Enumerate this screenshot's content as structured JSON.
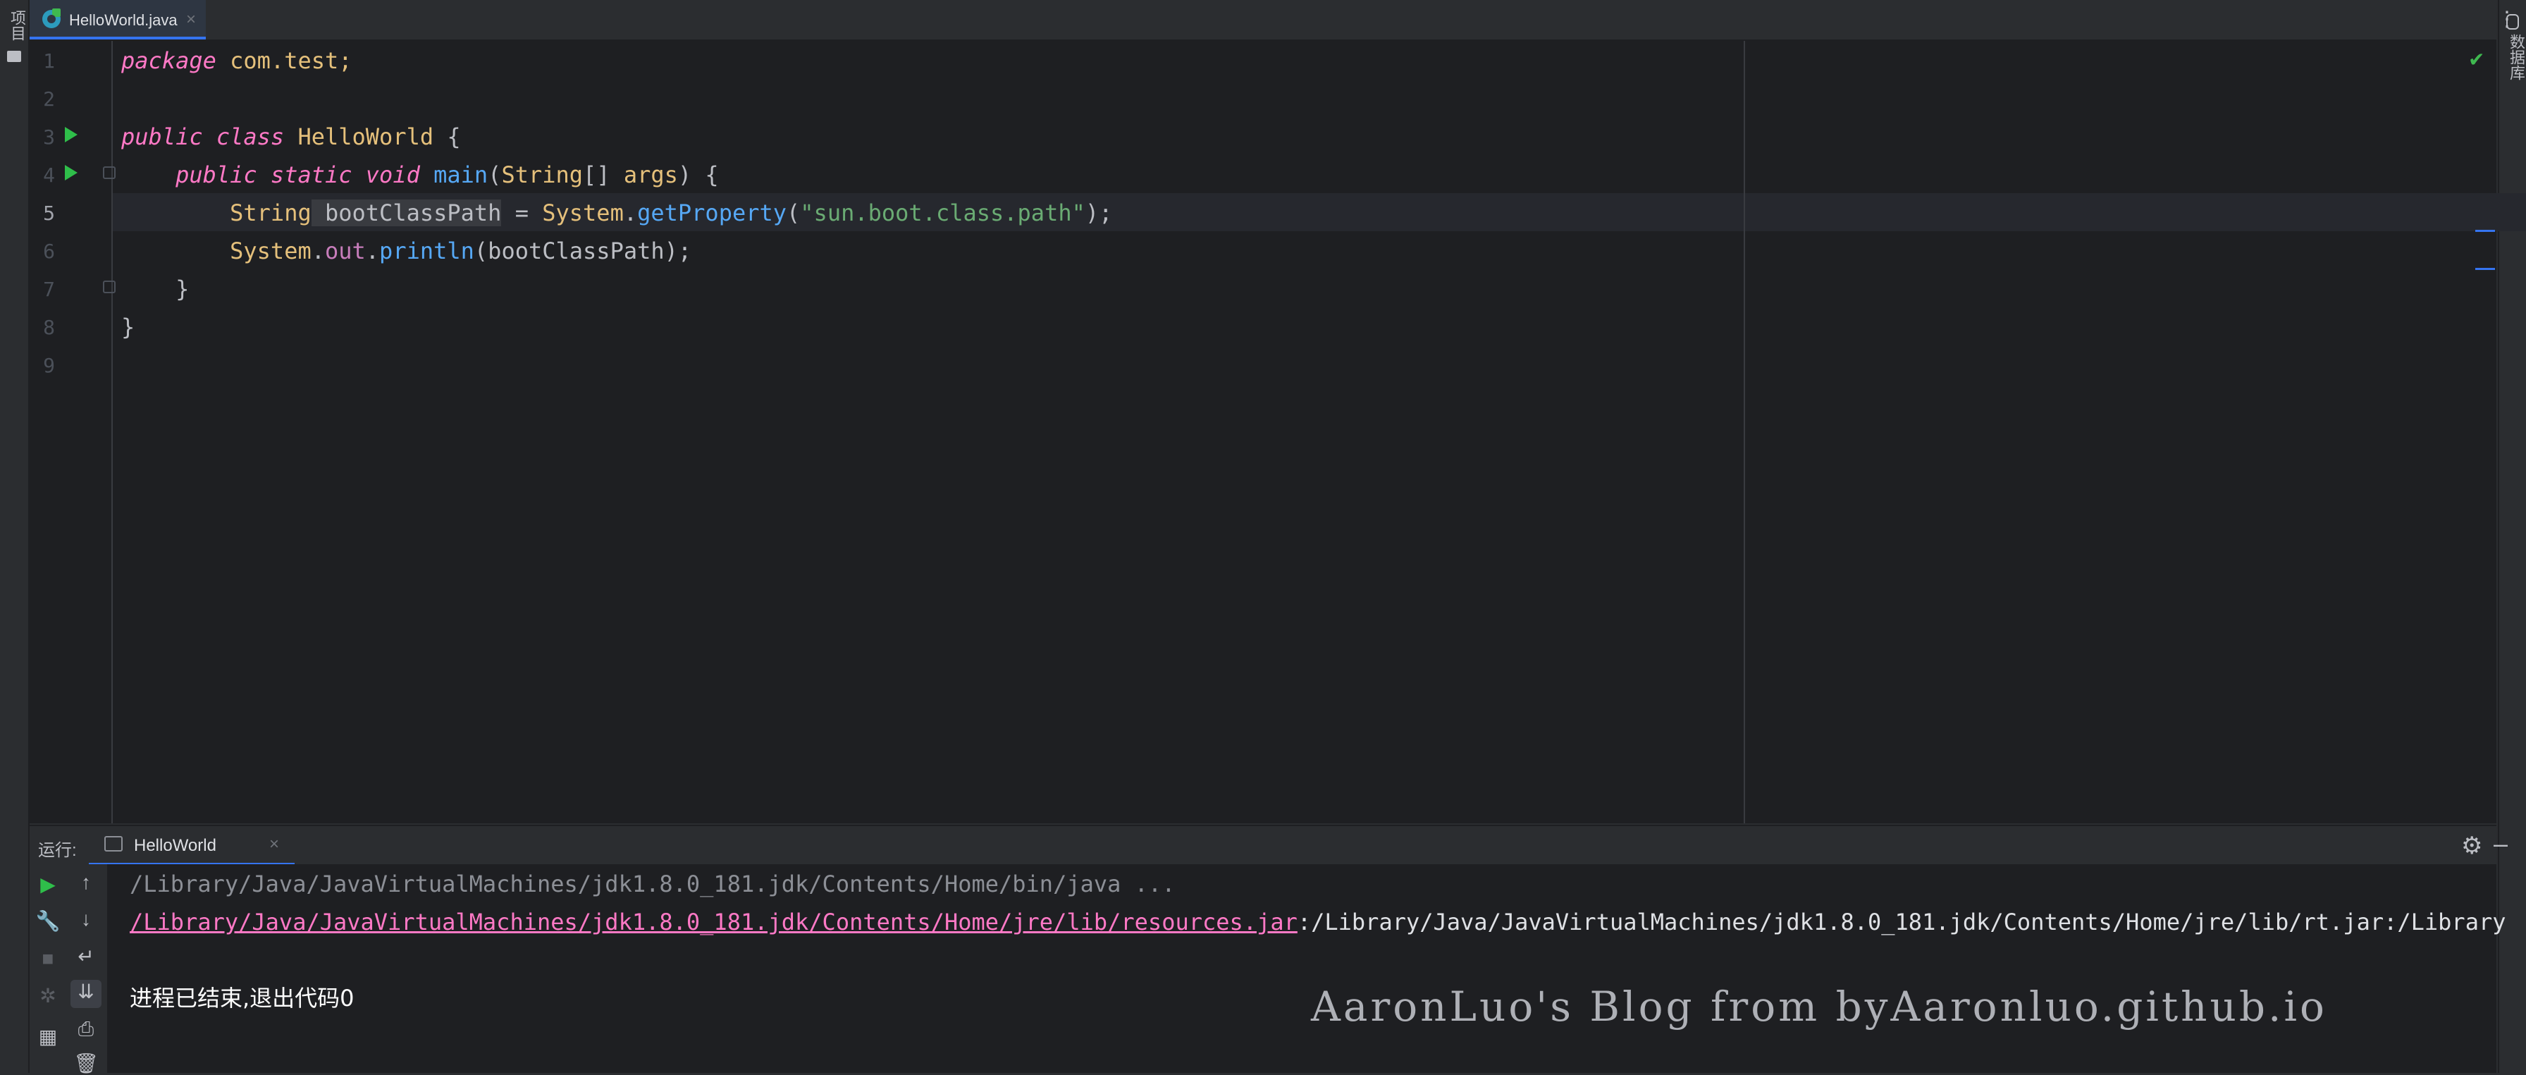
{
  "left_strip": {
    "project_label": "项目"
  },
  "right_strip": {
    "database_label": "数据库"
  },
  "editor_tab": {
    "label": "HelloWorld.java",
    "close": "×"
  },
  "editor": {
    "line_numbers": [
      "1",
      "2",
      "3",
      "4",
      "5",
      "6",
      "7",
      "8",
      "9"
    ],
    "code": {
      "l1": {
        "kw": "package",
        "rest": " com.test;"
      },
      "l3": {
        "kw1": "public",
        "kw2": " class",
        "type": " HelloWorld",
        "rest": " {"
      },
      "l4": {
        "indent": "    ",
        "kw1": "public",
        "kw2": " static",
        "kw3": " void",
        "fn": " main",
        "p1": "(",
        "type": "String",
        "p2": "[] ",
        "arg": "args",
        "p3": ") {"
      },
      "l5": {
        "indent": "        ",
        "type": "String",
        "var": " bootClassPath",
        "eq": " = ",
        "cls": "System",
        "dot": ".",
        "fn": "getProperty",
        "p1": "(",
        "str": "\"sun.boot.class.path\"",
        "p2": ");"
      },
      "l6": {
        "indent": "        ",
        "cls": "System",
        "dot1": ".",
        "field": "out",
        "dot2": ".",
        "fn": "println",
        "rest": "(bootClassPath);"
      },
      "l7": {
        "text": "    }"
      },
      "l8": {
        "text": "}"
      }
    }
  },
  "run_panel": {
    "title": "运行:",
    "tab_label": "HelloWorld",
    "tab_close": "×",
    "console": {
      "line1": "/Library/Java/JavaVirtualMachines/jdk1.8.0_181.jdk/Contents/Home/bin/java ...",
      "line2_link": "/Library/Java/JavaVirtualMachines/jdk1.8.0_181.jdk/Contents/Home/jre/lib/resources.jar",
      "line2_rest": ":/Library/Java/JavaVirtualMachines/jdk1.8.0_181.jdk/Contents/Home/jre/lib/rt.jar:/Library",
      "line2_sep": ":",
      "line4": "进程已结束,退出代码0"
    }
  },
  "watermark": "AaronLuo's Blog from byAaronluo.github.io",
  "colors": {
    "accent": "#3574f0",
    "run_green": "#2fbe4a",
    "link_pink": "#ff79c6"
  }
}
